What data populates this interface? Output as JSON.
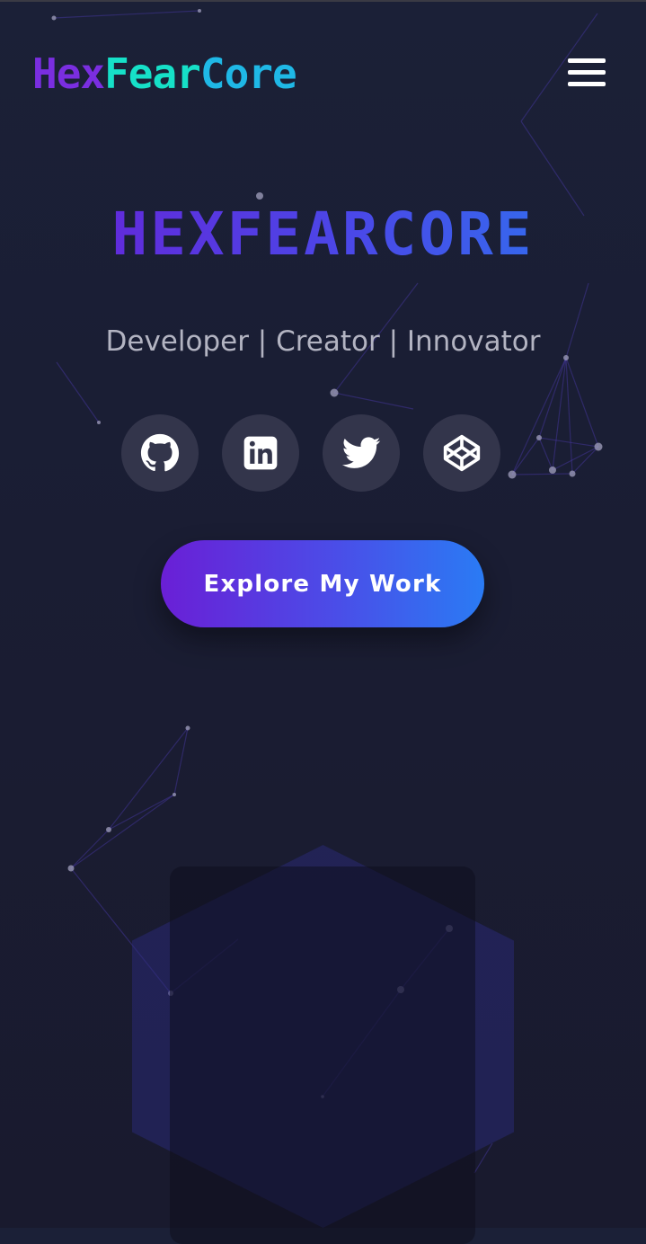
{
  "header": {
    "logo_part1": "Hex",
    "logo_part2": "Fear",
    "logo_part3": "Core",
    "menu_icon": "hamburger-menu-icon"
  },
  "hero": {
    "title": "HEXFEARCORE",
    "tagline": "Developer | Creator | Innovator",
    "cta_label": "Explore My Work"
  },
  "social_links": [
    {
      "icon": "github-icon"
    },
    {
      "icon": "linkedin-icon"
    },
    {
      "icon": "twitter-icon"
    },
    {
      "icon": "codepen-icon"
    }
  ],
  "colors": {
    "background": "#1b1e34",
    "logo_hex": "#7a2ee0",
    "logo_fear": "#16e0c8",
    "logo_core": "#1fb8e6",
    "accent_purple": "#6a1fd6",
    "accent_blue": "#2a7bf4",
    "tagline": "#b3b4c2",
    "social_bg": "#33354b"
  }
}
